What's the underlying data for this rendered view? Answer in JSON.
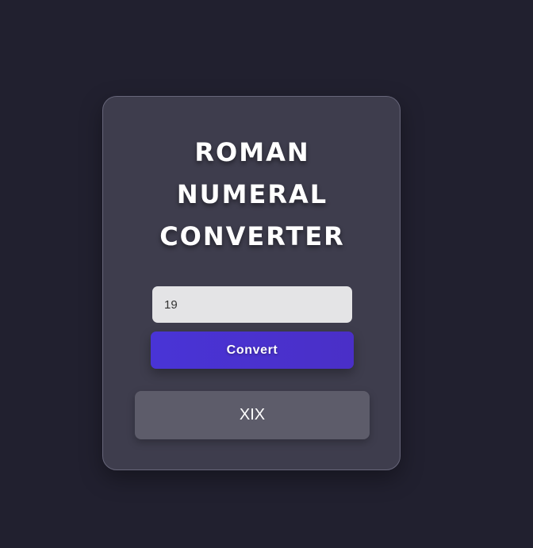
{
  "converter": {
    "title_lines": [
      "ROMAN",
      "NUMERAL",
      "CONVERTER"
    ],
    "input_value": "19",
    "convert_label": "Convert",
    "result": "XIX"
  },
  "colors": {
    "page_background": "#21202f",
    "card_background": "#3e3d4d",
    "button_accent": "#4934d6",
    "result_background": "#5d5c6a"
  }
}
